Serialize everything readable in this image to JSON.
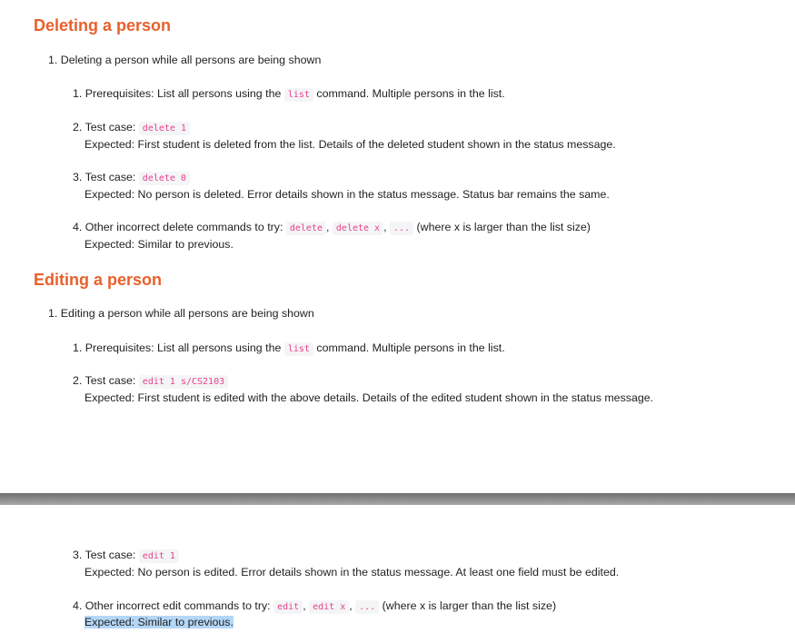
{
  "delete_section": {
    "heading": "Deleting a person",
    "item_number": "1.",
    "item_text": "Deleting a person while all persons are being shown",
    "steps": [
      {
        "number": "1.",
        "text_before": "Prerequisites: List all persons using the",
        "code": "list",
        "text_after": "command. Multiple persons in the list."
      },
      {
        "number": "2.",
        "label": "Test case:",
        "code": "delete 1",
        "expected": "Expected: First student is deleted from the list. Details of the deleted student shown in the status message."
      },
      {
        "number": "3.",
        "label": "Test case:",
        "code": "delete 0",
        "expected": "Expected: No person is deleted. Error details shown in the status message. Status bar remains the same."
      },
      {
        "number": "4.",
        "label": "Other incorrect delete commands to try:",
        "codes": [
          "delete",
          "delete x",
          "..."
        ],
        "separator": ",",
        "note": "(where x is larger than the list size)",
        "expected": "Expected: Similar to previous."
      }
    ]
  },
  "edit_section": {
    "heading": "Editing a person",
    "item_number": "1.",
    "item_text": "Editing a person while all persons are being shown",
    "steps": [
      {
        "number": "1.",
        "text_before": "Prerequisites: List all persons using the",
        "code": "list",
        "text_after": "command. Multiple persons in the list."
      },
      {
        "number": "2.",
        "label": "Test case:",
        "code": "edit 1 s/CS2103",
        "expected": "Expected: First student is edited with the above details. Details of the edited student shown in the status message."
      },
      {
        "number": "3.",
        "label": "Test case:",
        "code": "edit 1",
        "expected": "Expected: No person is edited. Error details shown in the status message. At least one field must be edited."
      },
      {
        "number": "4.",
        "label": "Other incorrect edit commands to try:",
        "codes": [
          "edit",
          "edit x",
          "..."
        ],
        "separator": ",",
        "note": "(where x is larger than the list size)",
        "expected": "Expected: Similar to previous."
      }
    ]
  },
  "colors": {
    "heading": "#e8602c",
    "code_text": "#e83e8c",
    "code_background": "#f4f5f6",
    "selection_highlight": "#b4d7f7",
    "page_break": "#8e8e8e"
  }
}
